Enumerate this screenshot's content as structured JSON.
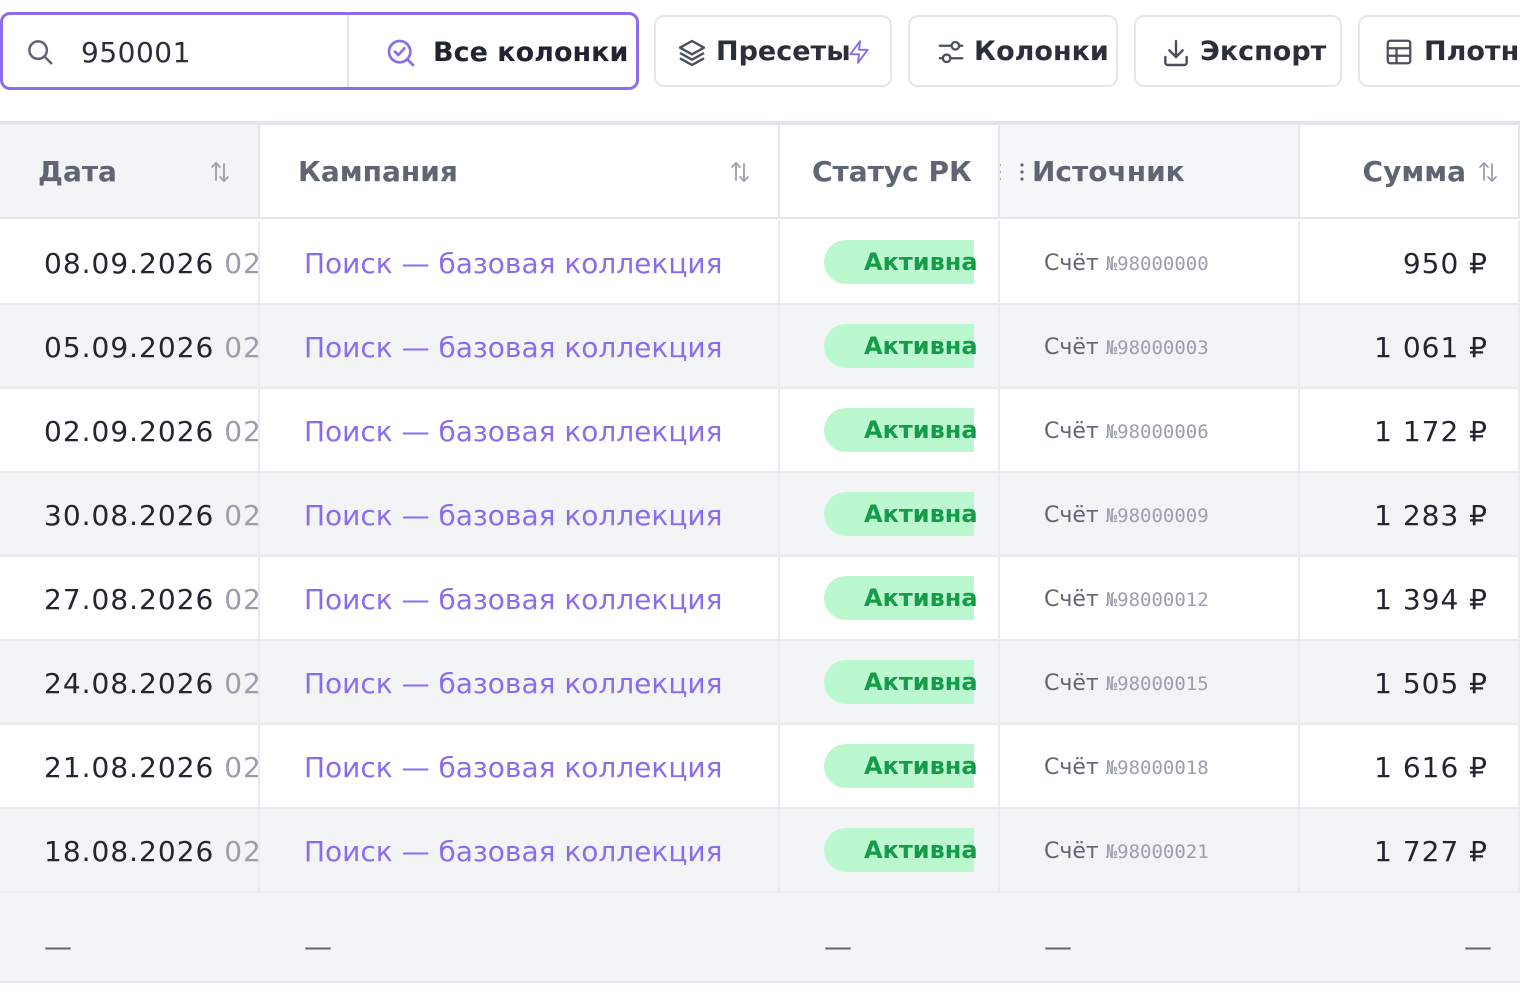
{
  "toolbar": {
    "search": {
      "value": "950001",
      "placeholder": ""
    },
    "scope_label": "Все колонки",
    "presets_label": "Пресеты",
    "columns_label": "Колонки",
    "export_label": "Экспорт",
    "density_label": "Плотно",
    "icons": {
      "search": "search-icon",
      "scope": "check-circle-search-icon",
      "presets": "layers-icon",
      "presets_extra": "lightning-icon",
      "columns": "sliders-icon",
      "export": "download-icon",
      "density": "table-grid-icon"
    }
  },
  "table": {
    "columns": {
      "date": "Дата",
      "campaign": "Кампания",
      "status": "Статус РК",
      "source": "Источник",
      "sum": "Сумма"
    },
    "rows": [
      {
        "date": "08.09.2026",
        "time": "02",
        "campaign": "Поиск — базовая коллекция",
        "status": "Активна",
        "source_label": "Счёт",
        "source_num": "№98000000",
        "sum": "950 ₽"
      },
      {
        "date": "05.09.2026",
        "time": "02",
        "campaign": "Поиск — базовая коллекция",
        "status": "Активна",
        "source_label": "Счёт",
        "source_num": "№98000003",
        "sum": "1 061 ₽"
      },
      {
        "date": "02.09.2026",
        "time": "02",
        "campaign": "Поиск — базовая коллекция",
        "status": "Активна",
        "source_label": "Счёт",
        "source_num": "№98000006",
        "sum": "1 172 ₽"
      },
      {
        "date": "30.08.2026",
        "time": "02",
        "campaign": "Поиск — базовая коллекция",
        "status": "Активна",
        "source_label": "Счёт",
        "source_num": "№98000009",
        "sum": "1 283 ₽"
      },
      {
        "date": "27.08.2026",
        "time": "02",
        "campaign": "Поиск — базовая коллекция",
        "status": "Активна",
        "source_label": "Счёт",
        "source_num": "№98000012",
        "sum": "1 394 ₽"
      },
      {
        "date": "24.08.2026",
        "time": "02",
        "campaign": "Поиск — базовая коллекция",
        "status": "Активна",
        "source_label": "Счёт",
        "source_num": "№98000015",
        "sum": "1 505 ₽"
      },
      {
        "date": "21.08.2026",
        "time": "02",
        "campaign": "Поиск — базовая коллекция",
        "status": "Активна",
        "source_label": "Счёт",
        "source_num": "№98000018",
        "sum": "1 616 ₽"
      },
      {
        "date": "18.08.2026",
        "time": "02",
        "campaign": "Поиск — базовая коллекция",
        "status": "Активна",
        "source_label": "Счёт",
        "source_num": "№98000021",
        "sum": "1 727 ₽"
      }
    ],
    "footer": {
      "date": "—",
      "campaign": "—",
      "status": "—",
      "source": "—",
      "sum": "—"
    }
  },
  "colors": {
    "accent": "#8b6cf0",
    "badge_bg": "#bbf7cf",
    "badge_text": "#159c4a",
    "stripe": "#f3f4f6"
  }
}
